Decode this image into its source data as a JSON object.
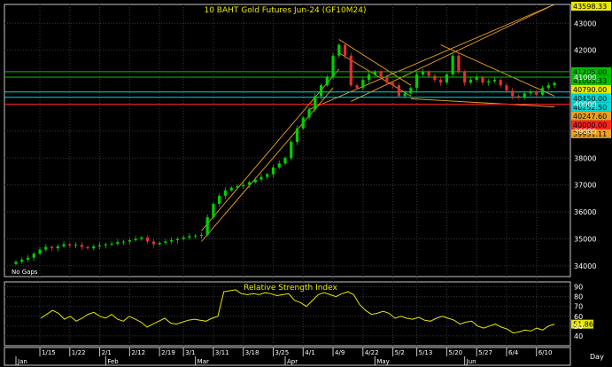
{
  "window": {
    "title": "10 BAHT Gold Futures Jun-24 (GF10M24)",
    "no_gaps_label": "No Gaps",
    "period_label": "Day"
  },
  "colors": {
    "background": "#000000",
    "frame": "#c8c8c8",
    "up_candle": "#00d000",
    "down_candle": "#e03030",
    "trendline": "#e8a020",
    "rsi_line": "#e8e800",
    "hline_green": "#00c000",
    "hline_cyan": "#00d8d8",
    "hline_red": "#ff2020"
  },
  "chart_data": [
    {
      "type": "candlestick",
      "title": "10 BAHT Gold Futures Jun-24 (GF10M24)",
      "ylim": [
        33600,
        43700
      ],
      "y_ticks": [
        34000,
        35000,
        36000,
        37000,
        38000,
        39000,
        40000,
        41000,
        42000,
        43000
      ],
      "x_tick_labels": [
        "1/15",
        "1/22",
        "2/1",
        "2/12",
        "2/19",
        "3/1",
        "3/11",
        "3/18",
        "3/25",
        "4/1",
        "4/9",
        "4/22",
        "5/2",
        "5/13",
        "5/20",
        "5/27",
        "6/4",
        "6/10"
      ],
      "month_labels": [
        "Jan",
        "Feb",
        "Mar",
        "Apr",
        "May",
        "Jun"
      ],
      "closes": [
        34150,
        34230,
        34300,
        34450,
        34600,
        34700,
        34650,
        34720,
        34800,
        34750,
        34780,
        34700,
        34650,
        34720,
        34760,
        34800,
        34820,
        34880,
        34900,
        34950,
        35000,
        35050,
        34900,
        34800,
        34850,
        34900,
        34950,
        35000,
        35050,
        35100,
        35120,
        35150,
        35800,
        36300,
        36600,
        36800,
        36900,
        36950,
        37000,
        37100,
        37200,
        37300,
        37400,
        37650,
        37800,
        38000,
        38600,
        39100,
        39500,
        39800,
        40300,
        40700,
        41000,
        41800,
        42200,
        41800,
        40700,
        40600,
        40900,
        41100,
        41200,
        41000,
        40800,
        40700,
        40300,
        40400,
        40600,
        41100,
        41200,
        41050,
        40900,
        40800,
        41100,
        41800,
        41200,
        40800,
        40900,
        41000,
        40800,
        40850,
        40900,
        40700,
        40500,
        40300,
        40250,
        40400,
        40450,
        40350,
        40600,
        40700,
        40790
      ],
      "horizontal_lines": [
        {
          "price": 41205.0,
          "label": "41205.00",
          "color": "#00c000",
          "label_bg": "#00c000"
        },
        {
          "price": 41003.33,
          "label": "41003.33",
          "color": "#00c000",
          "label_bg": "#00c000"
        },
        {
          "price": 40790.0,
          "label": "40790.00",
          "color": "#e8e800",
          "label_bg": "#e8e800"
        },
        {
          "price": 40450.0,
          "label": "40450.00",
          "color": "#00d8d8",
          "label_bg": "#00d8d8"
        },
        {
          "price": 40252.5,
          "label": "40252.50",
          "color": "#00d8d8",
          "label_bg": "#00d8d8"
        },
        {
          "price": 40247.6,
          "label": "40247.60",
          "color": "#e8a020",
          "label_bg": "#e8a020"
        },
        {
          "price": 40000.0,
          "label": "40000.00",
          "color": "#ff2020",
          "label_bg": "#ff2020"
        },
        {
          "price": 39931.11,
          "label": "39931.11",
          "color": "#e8a020",
          "label_bg": "#e8a020"
        }
      ],
      "top_label": "43598.33"
    },
    {
      "type": "line",
      "title": "Relative Strength Index",
      "ylim": [
        30,
        95
      ],
      "y_ticks": [
        40,
        50,
        60,
        70,
        80,
        90
      ],
      "current_label": "51.86",
      "values": [
        58,
        62,
        66,
        63,
        57,
        60,
        55,
        58,
        62,
        64,
        60,
        58,
        62,
        57,
        55,
        60,
        57,
        54,
        49,
        52,
        55,
        58,
        53,
        52,
        54,
        56,
        57,
        56,
        55,
        58,
        60,
        85,
        86,
        87,
        83,
        82,
        83,
        82,
        84,
        83,
        81,
        82,
        83,
        76,
        74,
        70,
        76,
        82,
        84,
        82,
        80,
        83,
        85,
        82,
        72,
        66,
        62,
        63,
        65,
        63,
        58,
        60,
        58,
        57,
        59,
        56,
        55,
        58,
        60,
        58,
        56,
        52,
        54,
        55,
        50,
        48,
        50,
        52,
        49,
        47,
        43,
        44,
        46,
        45,
        48,
        46,
        50,
        52
      ]
    }
  ]
}
